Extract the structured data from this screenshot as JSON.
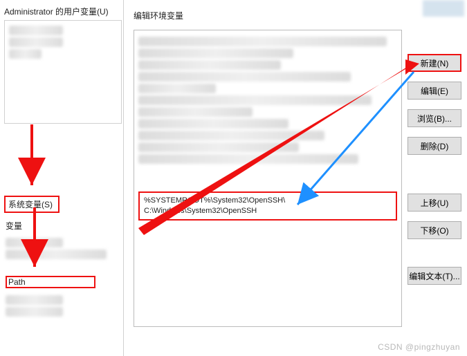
{
  "left": {
    "user_vars_label": "Administrator 的用户变量(U)",
    "user_rows": [
      "量",
      "tmp",
      " "
    ],
    "system_vars_label": "系统变量(S)",
    "col_header": "变量",
    "sys_rows_blur": [
      " - ",
      "PRO",
      "S"
    ],
    "path_row": "Path"
  },
  "right": {
    "title": "编辑环境变量",
    "highlighted_entries": [
      "%SYSTEMROOT%\\System32\\OpenSSH\\",
      "C:\\Windows\\System32\\OpenSSH"
    ],
    "buttons": {
      "new": "新建(N)",
      "edit": "编辑(E)",
      "browse": "浏览(B)...",
      "delete": "删除(D)",
      "move_up": "上移(U)",
      "move_down": "下移(O)",
      "edit_text": "编辑文本(T)..."
    }
  },
  "watermark": "CSDN @pingzhuyan"
}
